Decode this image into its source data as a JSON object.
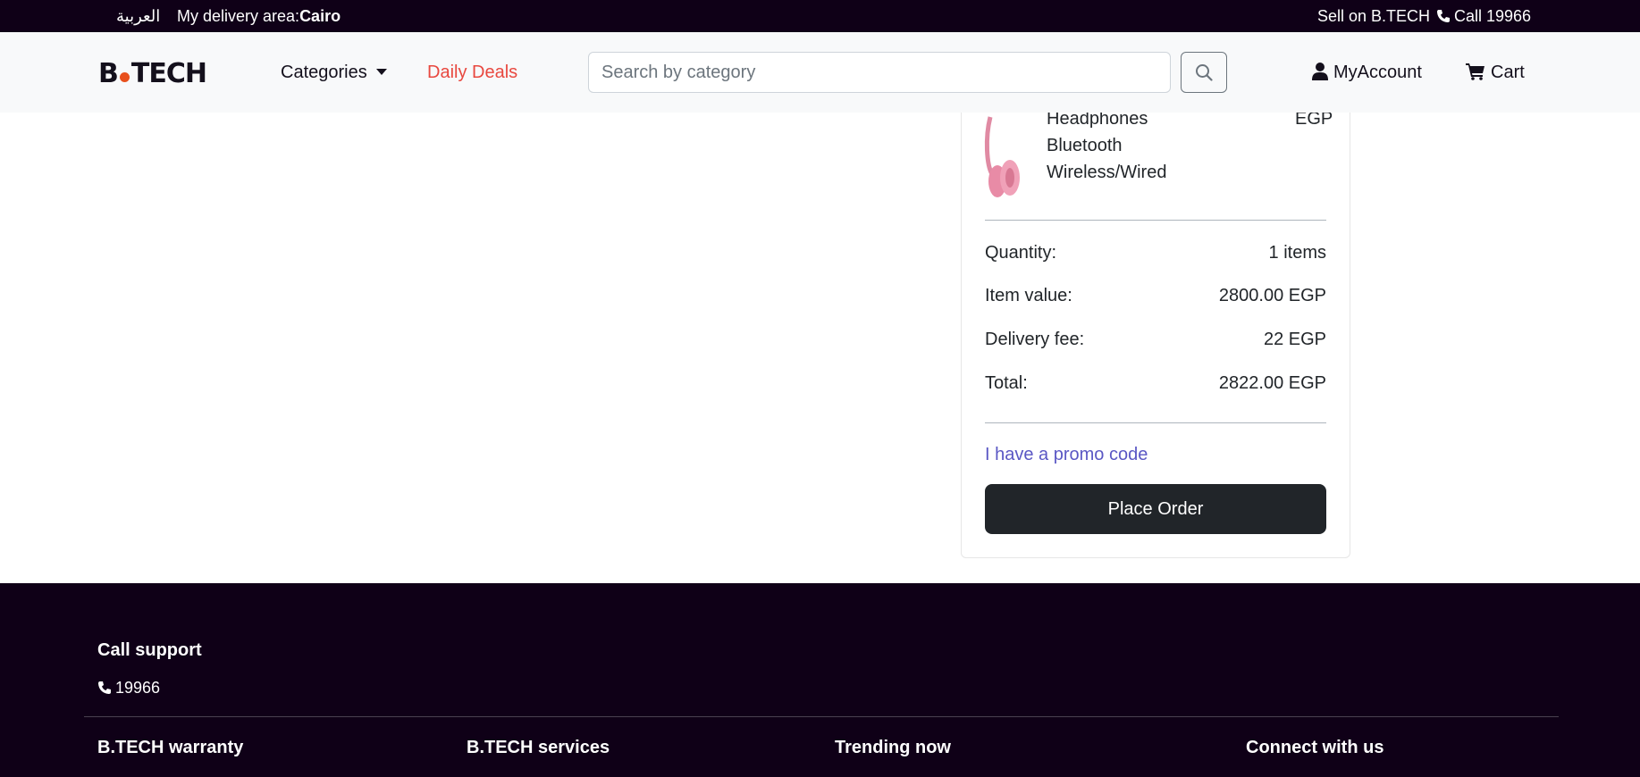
{
  "topbar": {
    "language": "العربية",
    "delivery_label": "My delivery area:",
    "delivery_city": "Cairo",
    "sell": "Sell on B.TECH",
    "call": "Call 19966"
  },
  "header": {
    "logo_left": "B",
    "logo_right": "TECH",
    "categories": "Categories",
    "daily_deals": "Daily Deals",
    "search_placeholder": "Search by category",
    "account": "MyAccount",
    "cart": "Cart"
  },
  "summary": {
    "product_name_lines": [
      "Headphones",
      "Bluetooth",
      "Wireless/Wired"
    ],
    "product_price_unit": "EGP",
    "quantity_label": "Quantity:",
    "quantity_value": "1 items",
    "item_value_label": "Item value:",
    "item_value": "2800.00 EGP",
    "delivery_label": "Delivery fee:",
    "delivery_value": "22 EGP",
    "total_label": "Total:",
    "total_value": "2822.00 EGP",
    "promo": "I have a promo code",
    "place_order": "Place Order"
  },
  "footer": {
    "call_support": "Call support",
    "support_phone": "19966",
    "columns": [
      "B.TECH warranty",
      "B.TECH services",
      "Trending now",
      "Connect with us"
    ]
  },
  "colors": {
    "dark": "#0f0017",
    "deals": "#e8483f",
    "promo": "#5a57c4",
    "button": "#212529",
    "logo_dot": "#e8501d"
  }
}
